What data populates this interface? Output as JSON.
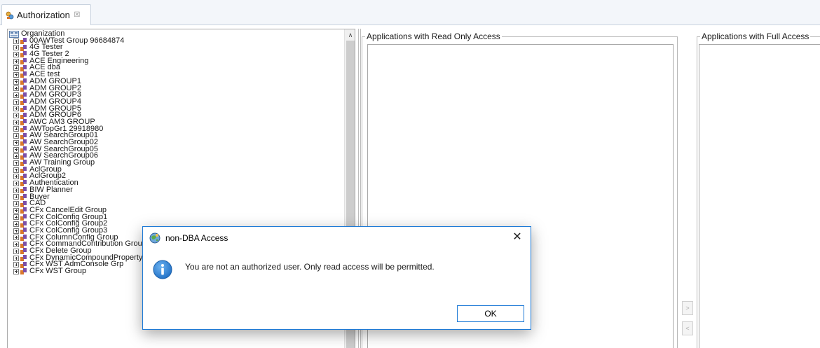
{
  "tab": {
    "label": "Authorization",
    "close_glyph": "☒",
    "icon": "authorization-icon"
  },
  "tree": {
    "root_label": "Organization",
    "items": [
      "00AWTest Group 96684874",
      "4G Tester",
      "4G Tester 2",
      "ACE Engineering",
      "ACE dba",
      "ACE test",
      "ADM GROUP1",
      "ADM GROUP2",
      "ADM GROUP3",
      "ADM GROUP4",
      "ADM GROUP5",
      "ADM GROUP6",
      "AWC AM3 GROUP",
      "AWTopGr1 29918980",
      "AW SearchGroup01",
      "AW SearchGroup02",
      "AW SearchGroup05",
      "AW SearchGroup06",
      "AW Training Group",
      "AclGroup",
      "AclGroup2",
      "Authentication",
      "BIW Planner",
      "Buyer",
      "CAD",
      "CFx CancelEdit Group",
      "CFx ColConfig Group1",
      "CFx ColConfig Group2",
      "CFx ColConfig Group3",
      "CFx ColumnConfig Group",
      "CFx CommandContribution Group",
      "CFx Delete Group",
      "CFx DynamicCompoundProperty Group",
      "CFx WST AdmConsole Grp",
      "CFx WST Group"
    ],
    "scroll_up_glyph": "∧"
  },
  "read_only": {
    "title": "Applications with Read Only Access"
  },
  "full_access": {
    "title": "Applications with Full Access"
  },
  "move_buttons": {
    "add": ">",
    "remove": "<"
  },
  "dialog": {
    "title": "non-DBA Access",
    "close_glyph": "✕",
    "message": "You are not an authorized user. Only read access will be permitted.",
    "ok_label": "OK"
  },
  "colors": {
    "dialog_border": "#1e7ad6",
    "info_icon": "#1f6fc5",
    "group_icon_orange": "#d9782d",
    "group_icon_purple": "#7b4fa8"
  }
}
